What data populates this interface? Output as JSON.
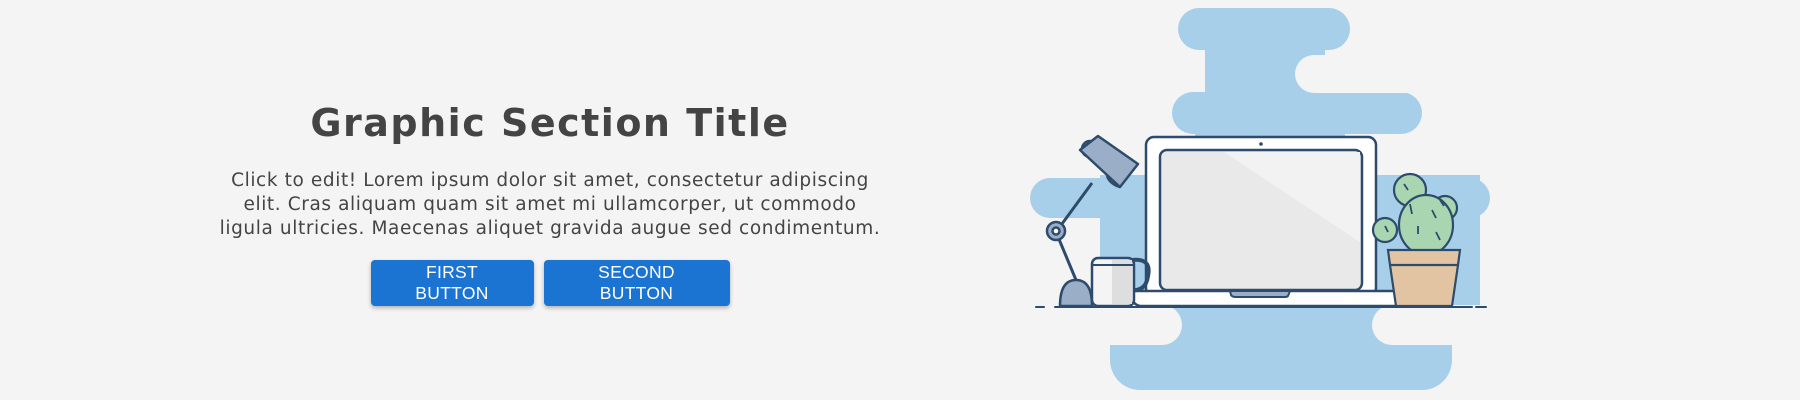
{
  "section": {
    "title": "Graphic Section Title",
    "body": "Click to edit! Lorem ipsum dolor sit amet, consectetur adipiscing elit. Cras aliquam quam sit amet mi ullamcorper, ut commodo ligula ultricies. Maecenas aliquet gravida augue sed condimentum."
  },
  "buttons": {
    "first_label": "FIRST BUTTON",
    "second_label": "SECOND BUTTON"
  },
  "colors": {
    "background": "#f4f4f4",
    "text": "#444444",
    "button": "#1b74d2",
    "blob": "#a8cfea",
    "outline": "#2e4b6d",
    "screen": "#e9e9e9",
    "cactus": "#a9d6b0",
    "pot": "#e2c4a3",
    "lamp": "#9aafc7"
  },
  "illustration": {
    "icons": [
      "laptop-icon",
      "desk-lamp-icon",
      "coffee-mug-icon",
      "cactus-plant-icon"
    ]
  }
}
